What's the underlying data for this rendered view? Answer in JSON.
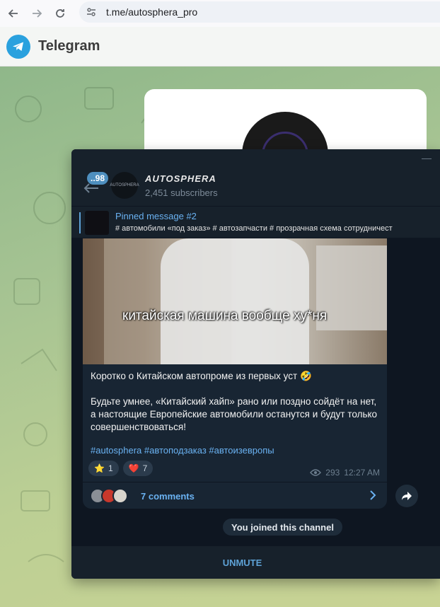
{
  "browser": {
    "url": "t.me/autosphera_pro"
  },
  "telegram_header": {
    "title": "Telegram"
  },
  "channel": {
    "name": "AUTOSPHERA",
    "subscribers": "2,451 subscribers",
    "unread_badge": "..98",
    "avatar_text": "AUTOSPHERA"
  },
  "pinned": {
    "title": "Pinned message #2",
    "text": "# автомобили «под заказ» # автозапчасти  # прозрачная схема сотрудничест"
  },
  "message": {
    "video_caption": "китайская машина вообще ху*ня",
    "line1": "Коротко о Китайском автопроме из первых уст 🤣",
    "line2": "Будьте умнее, «Китайский хайп» рано или поздно сойдёт на нет,",
    "line3": "а настоящие Европейские автомобили останутся и будут только",
    "line4": "совершенствоваться!",
    "hashtags": "#autosphera #автоподзаказ #автоизевропы",
    "reactions": [
      {
        "emoji": "⭐",
        "count": "1"
      },
      {
        "emoji": "❤️",
        "count": "7"
      }
    ],
    "views": "293",
    "time": "12:27 AM",
    "comments_label": "7 comments"
  },
  "service_message": "You joined this channel",
  "bottom_action": "UNMUTE",
  "colors": {
    "accent": "#6ab2f2",
    "window_bg": "#17212b",
    "chat_bg": "#0e1621",
    "bubble_bg": "#182533",
    "telegram_blue": "#2aa1de"
  },
  "icons": [
    "back-arrow-icon",
    "forward-arrow-icon",
    "reload-icon",
    "site-settings-icon",
    "telegram-logo-icon",
    "minimize-icon",
    "eye-icon",
    "chevron-right-icon",
    "share-icon"
  ]
}
